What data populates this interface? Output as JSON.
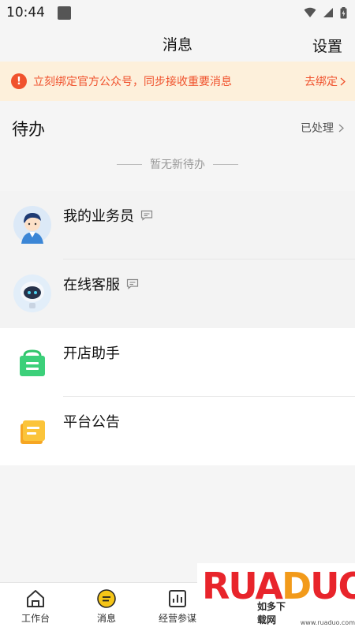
{
  "status_bar": {
    "time": "10:44"
  },
  "header": {
    "title": "消息",
    "settings": "设置"
  },
  "banner": {
    "text": "立刻绑定官方公众号，同步接收重要消息",
    "action": "去绑定"
  },
  "todo": {
    "title": "待办",
    "processed": "已处理",
    "empty": "暂无新待办"
  },
  "messages": [
    {
      "label": "我的业务员",
      "has_chat_icon": true
    },
    {
      "label": "在线客服",
      "has_chat_icon": true
    },
    {
      "label": "开店助手",
      "has_chat_icon": false
    },
    {
      "label": "平台公告",
      "has_chat_icon": false
    }
  ],
  "tabbar": {
    "items": [
      {
        "label": "工作台",
        "icon": "home-icon"
      },
      {
        "label": "消息",
        "icon": "message-icon",
        "active": true
      },
      {
        "label": "经营参谋",
        "icon": "chart-icon"
      }
    ]
  },
  "watermark": {
    "logo": "RUANDUO",
    "tagline": "如多下载网",
    "url": "www.ruaduo.com"
  },
  "colors": {
    "accent": "#f5c518",
    "alert": "#f0522d",
    "banner_bg": "#fdf0db"
  }
}
